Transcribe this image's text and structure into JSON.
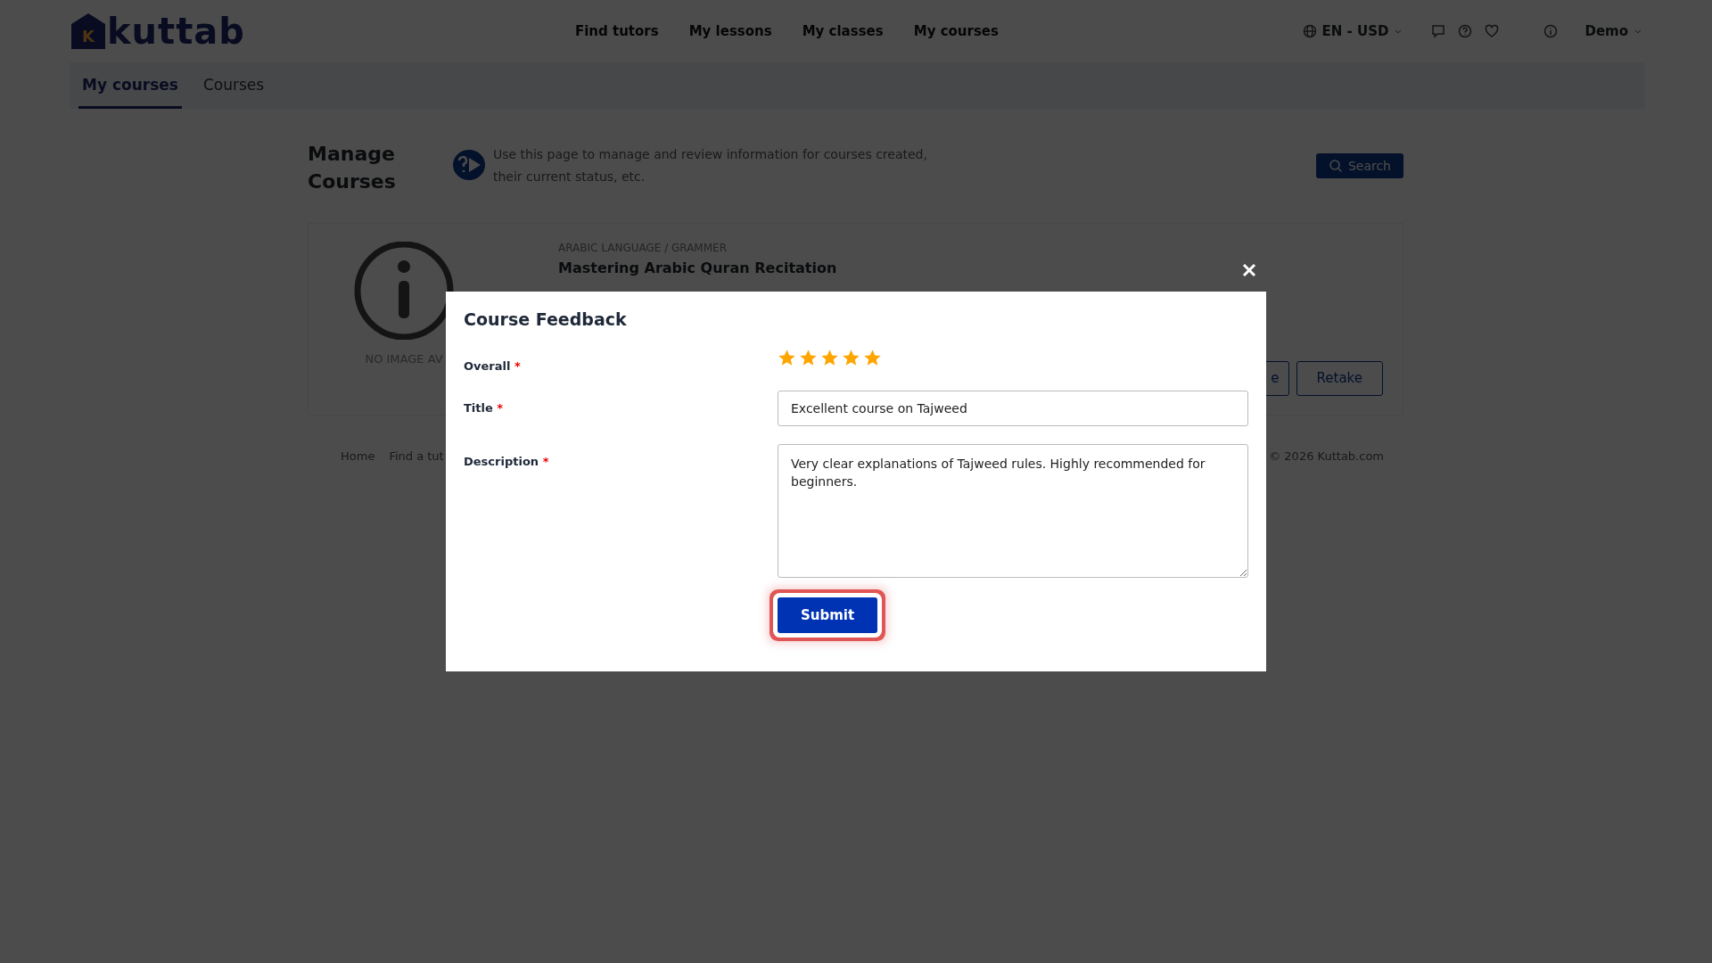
{
  "logo": {
    "mark": "K",
    "text": "kuttab"
  },
  "nav": [
    "Find tutors",
    "My lessons",
    "My classes",
    "My courses"
  ],
  "locale": "EN - USD",
  "user": "Demo",
  "tabs": [
    {
      "label": "My courses",
      "selected": true
    },
    {
      "label": "Courses",
      "selected": false
    }
  ],
  "page": {
    "title": "Manage Courses",
    "help": "Use this page to manage and review information for courses created, their current status, etc.",
    "search_button": "Search"
  },
  "course": {
    "image_text": "NO IMAGE AV",
    "category": "ARABIC LANGUAGE / GRAMMER",
    "title": "Mastering Arabic Quran Recitation",
    "buttons": [
      "e",
      "Retake"
    ]
  },
  "footer": {
    "links": [
      "Home",
      "Find a tut"
    ],
    "copyright": "© 2026 Kuttab.com"
  },
  "modal": {
    "title": "Course Feedback",
    "overall_label": "Overall",
    "stars": 5,
    "title_label": "Title",
    "title_value": "Excellent course on Tajweed",
    "description_label": "Description",
    "description_value": "Very clear explanations of Tajweed rules. Highly recommended for beginners.",
    "required_mark": "*",
    "submit": "Submit"
  }
}
